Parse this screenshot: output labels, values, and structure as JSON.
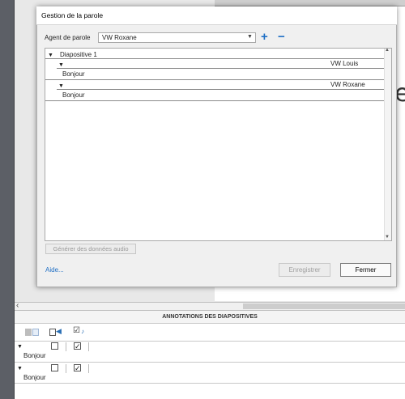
{
  "dialog": {
    "title": "Gestion de la parole",
    "agent_label": "Agent de parole",
    "agent_value": "VW Roxane",
    "add_symbol": "+",
    "remove_symbol": "−",
    "tree": {
      "slide_label": "Diapositive 1",
      "items": [
        {
          "voice": "VW Louis",
          "text": "Bonjour"
        },
        {
          "voice": "VW Roxane",
          "text": "Bonjour"
        }
      ]
    },
    "generate_audio_label": "Générer des données audio",
    "help_label": "Aide...",
    "save_label": "Enregistrer",
    "close_label": "Fermer"
  },
  "annotations": {
    "header": "ANNOTATIONS DES DIAPOSITIVES",
    "rows": [
      {
        "text": "Bonjour",
        "checked": false,
        "audio_checked": true
      },
      {
        "text": "Bonjour",
        "checked": false,
        "audio_checked": true
      }
    ]
  },
  "background": {
    "slide_letter": "e"
  },
  "icons": {
    "collapse": "triangle-down-icon",
    "scroll_left": "chevron-left-icon",
    "add": "plus-icon",
    "remove": "minus-icon"
  },
  "colors": {
    "accent": "#1f6fc5",
    "app_bg": "#5c5f66",
    "dialog_bg": "#f0f0f0"
  }
}
